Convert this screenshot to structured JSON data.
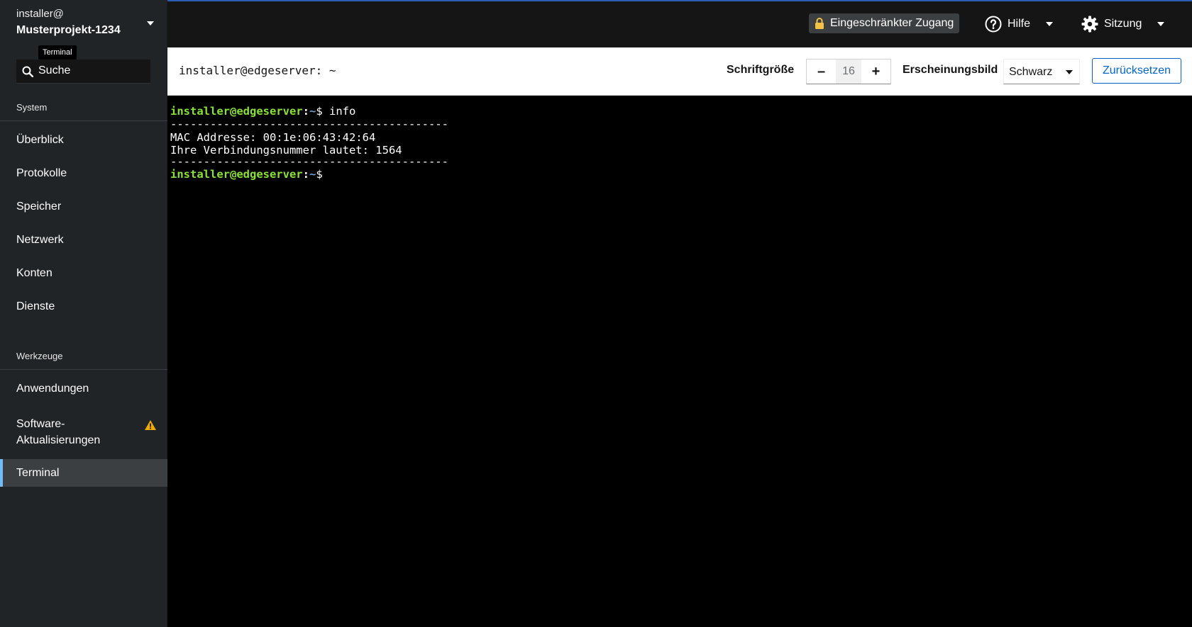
{
  "sidebar": {
    "host_user": "installer@",
    "host_name": "Musterprojekt-1234",
    "tooltip": "Terminal",
    "search_placeholder": "Suche",
    "sections": {
      "system": "System",
      "tools": "Werkzeuge"
    },
    "system_items": [
      "Überblick",
      "Protokolle",
      "Speicher",
      "Netzwerk",
      "Konten",
      "Dienste"
    ],
    "tool_items": {
      "applications": "Anwendungen",
      "updates_line1": "Software-",
      "updates_line2": "Aktualisierungen",
      "terminal": "Terminal"
    }
  },
  "topbar": {
    "restricted_label": "Eingeschränkter Zugang",
    "help_label": "Hilfe",
    "session_label": "Sitzung"
  },
  "toolbar": {
    "terminal_title": "installer@edgeserver: ~",
    "font_size_label": "Schriftgröße",
    "font_size_value": "16",
    "decrease_label": "–",
    "increase_label": "+",
    "appearance_label": "Erscheinungsbild",
    "appearance_value": "Schwarz",
    "reset_label": "Zurücksetzen"
  },
  "terminal": {
    "prompt_user": "installer@edgeserver",
    "prompt_colon": ":",
    "prompt_path": "~",
    "prompt_symbol": "$",
    "command": " info",
    "separator": "------------------------------------------",
    "mac_line": "MAC Addresse: 00:1e:06:43:42:64",
    "connection_line": "Ihre Verbindungsnummer lautet: 1564"
  },
  "colors": {
    "accent_blue": "#0066cc",
    "active_indicator": "#73bcf7",
    "prompt_green": "#8ae234",
    "prompt_blue": "#729fcf",
    "warning": "#f0ab00",
    "lock": "#f4c145"
  }
}
